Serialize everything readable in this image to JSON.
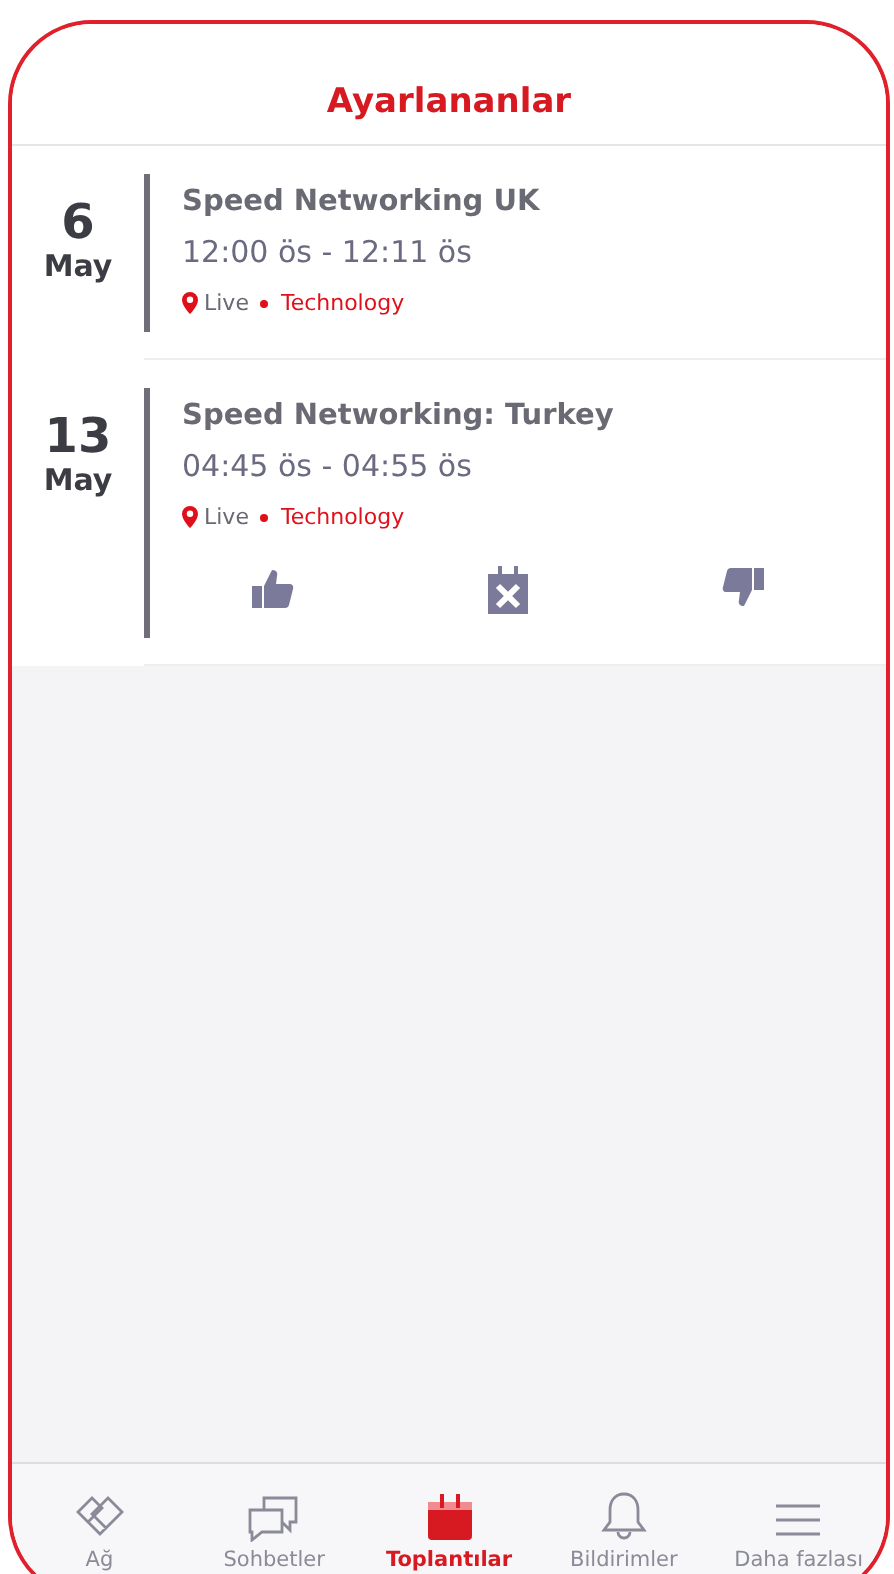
{
  "header": {
    "title": "Ayarlananlar"
  },
  "meetings": [
    {
      "day": "6",
      "month": "May",
      "title": "Speed Networking UK",
      "time": "12:00 ös - 12:11 ös",
      "location": "Live",
      "category": "Technology"
    },
    {
      "day": "13",
      "month": "May",
      "title": "Speed Networking: Turkey",
      "time": "04:45 ös - 04:55 ös",
      "location": "Live",
      "category": "Technology",
      "actions": [
        {
          "kind": "like"
        },
        {
          "kind": "cancel"
        },
        {
          "kind": "dislike"
        }
      ]
    }
  ],
  "tab_bar": [
    {
      "kind": "network",
      "label": "Ağ",
      "selected": false
    },
    {
      "kind": "chats",
      "label": "Sohbetler",
      "selected": false
    },
    {
      "kind": "meetings",
      "label": "Toplantılar",
      "selected": true
    },
    {
      "kind": "notifications",
      "label": "Bildirimler",
      "selected": false
    },
    {
      "kind": "more",
      "label": "Daha fazlası",
      "selected": false
    }
  ]
}
